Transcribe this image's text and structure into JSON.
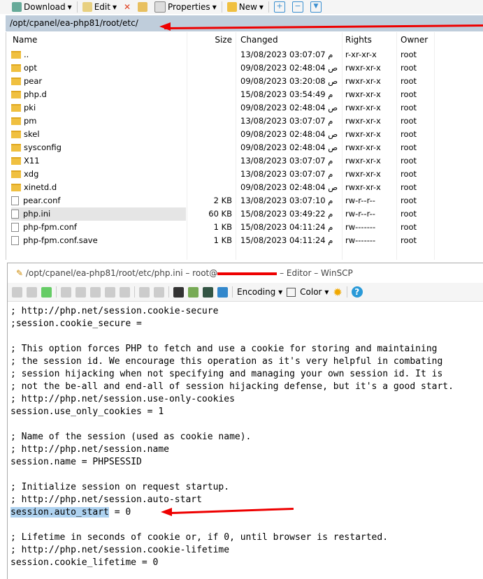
{
  "toolbar": {
    "download": "Download",
    "edit": "Edit",
    "properties": "Properties",
    "new": "New"
  },
  "path": "/opt/cpanel/ea-php81/root/etc/",
  "columns": {
    "name": "Name",
    "size": "Size",
    "changed": "Changed",
    "rights": "Rights",
    "owner": "Owner"
  },
  "files": [
    {
      "name": "..",
      "size": "",
      "changed": "13/08/2023 03:07:07 م",
      "rights": "r-xr-xr-x",
      "owner": "root",
      "type": "up"
    },
    {
      "name": "opt",
      "size": "",
      "changed": "09/08/2023 02:48:04 ص",
      "rights": "rwxr-xr-x",
      "owner": "root",
      "type": "folder"
    },
    {
      "name": "pear",
      "size": "",
      "changed": "09/08/2023 03:20:08 ص",
      "rights": "rwxr-xr-x",
      "owner": "root",
      "type": "folder"
    },
    {
      "name": "php.d",
      "size": "",
      "changed": "15/08/2023 03:54:49 م",
      "rights": "rwxr-xr-x",
      "owner": "root",
      "type": "folder"
    },
    {
      "name": "pki",
      "size": "",
      "changed": "09/08/2023 02:48:04 ص",
      "rights": "rwxr-xr-x",
      "owner": "root",
      "type": "folder"
    },
    {
      "name": "pm",
      "size": "",
      "changed": "13/08/2023 03:07:07 م",
      "rights": "rwxr-xr-x",
      "owner": "root",
      "type": "folder"
    },
    {
      "name": "skel",
      "size": "",
      "changed": "09/08/2023 02:48:04 ص",
      "rights": "rwxr-xr-x",
      "owner": "root",
      "type": "folder"
    },
    {
      "name": "sysconfig",
      "size": "",
      "changed": "09/08/2023 02:48:04 ص",
      "rights": "rwxr-xr-x",
      "owner": "root",
      "type": "folder"
    },
    {
      "name": "X11",
      "size": "",
      "changed": "13/08/2023 03:07:07 م",
      "rights": "rwxr-xr-x",
      "owner": "root",
      "type": "folder"
    },
    {
      "name": "xdg",
      "size": "",
      "changed": "13/08/2023 03:07:07 م",
      "rights": "rwxr-xr-x",
      "owner": "root",
      "type": "folder"
    },
    {
      "name": "xinetd.d",
      "size": "",
      "changed": "09/08/2023 02:48:04 ص",
      "rights": "rwxr-xr-x",
      "owner": "root",
      "type": "folder"
    },
    {
      "name": "pear.conf",
      "size": "2 KB",
      "changed": "13/08/2023 03:07:10 م",
      "rights": "rw-r--r--",
      "owner": "root",
      "type": "file"
    },
    {
      "name": "php.ini",
      "size": "60 KB",
      "changed": "15/08/2023 03:49:22 م",
      "rights": "rw-r--r--",
      "owner": "root",
      "type": "file",
      "selected": true
    },
    {
      "name": "php-fpm.conf",
      "size": "1 KB",
      "changed": "15/08/2023 04:11:24 م",
      "rights": "rw-------",
      "owner": "root",
      "type": "file"
    },
    {
      "name": "php-fpm.conf.save",
      "size": "1 KB",
      "changed": "15/08/2023 04:11:24 م",
      "rights": "rw-------",
      "owner": "root",
      "type": "file"
    }
  ],
  "editor": {
    "title_prefix": "/opt/cpanel/ea-php81/root/etc/php.ini – root@",
    "title_suffix": " – Editor – WinSCP",
    "encoding": "Encoding",
    "color": "Color",
    "lines": [
      "; http://php.net/session.cookie-secure",
      ";session.cookie_secure =",
      "",
      "; This option forces PHP to fetch and use a cookie for storing and maintaining",
      "; the session id. We encourage this operation as it's very helpful in combating",
      "; session hijacking when not specifying and managing your own session id. It is",
      "; not the be-all and end-all of session hijacking defense, but it's a good start.",
      "; http://php.net/session.use-only-cookies",
      "session.use_only_cookies = 1",
      "",
      "; Name of the session (used as cookie name).",
      "; http://php.net/session.name",
      "session.name = PHPSESSID",
      "",
      "; Initialize session on request startup.",
      "; http://php.net/session.auto-start",
      "",
      "",
      "; Lifetime in seconds of cookie or, if 0, until browser is restarted.",
      "; http://php.net/session.cookie-lifetime",
      "session.cookie_lifetime = 0"
    ],
    "highlight_text": "session.auto_start",
    "highlight_rest": " = 0"
  },
  "colors": {
    "pathbar": "#bfcddb",
    "selection": "#aed2f0",
    "annotation": "#e00000"
  }
}
